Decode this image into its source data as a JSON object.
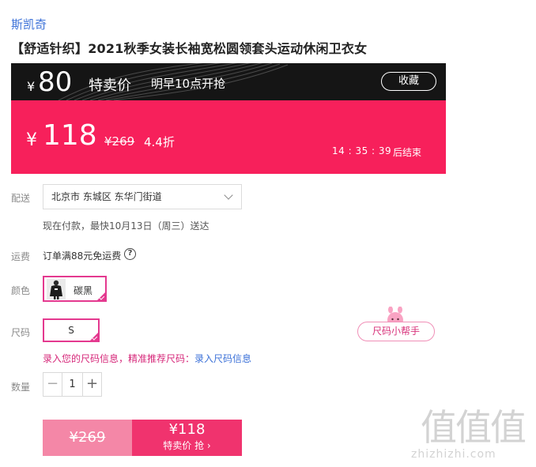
{
  "brand": "斯凯奇",
  "product_title": "【舒适针织】2021秋季女装长袖宽松圆领套头运动休闲卫衣女",
  "promo": {
    "presale_currency": "¥",
    "presale_amount": "80",
    "presale_label": "特卖价",
    "presale_time": "明早10点开抢",
    "favorite_label": "收藏",
    "current_currency": "¥",
    "current_amount": "118",
    "original_price": "¥269",
    "discount": "4.4折",
    "countdown": "14 : 35 : 39",
    "countdown_suffix": "后结束",
    "colors": {
      "dark": "#151515",
      "pink": "#f7205b"
    }
  },
  "delivery": {
    "label": "配送",
    "address": "北京市 东城区 东华门街道",
    "note": "现在付款，最快10月13日（周三）送达"
  },
  "shipping": {
    "label": "运费",
    "text": "订单满88元免运费",
    "help_icon": "question-circle-icon"
  },
  "color": {
    "label": "颜色",
    "selected": "碳黑",
    "accent": "#e4398f"
  },
  "size": {
    "label": "尺码",
    "selected": "S",
    "helper": "尺码小帮手",
    "hint": "录入您的尺码信息，精准推荐尺码：",
    "hint_link": "录入尺码信息"
  },
  "quantity": {
    "label": "数量",
    "value": "1",
    "minus": "−",
    "plus": "+"
  },
  "buy": {
    "original": "¥269",
    "flash_price": "¥118",
    "flash_label": "特卖价 抢 ›"
  },
  "watermark": {
    "chars": "值值值",
    "site": "zhizhizhi.com"
  }
}
